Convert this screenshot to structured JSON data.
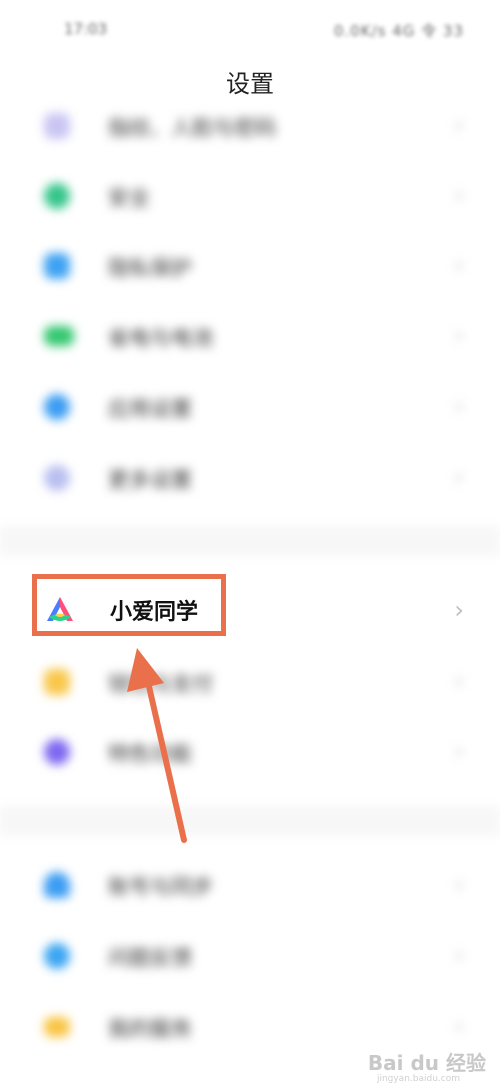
{
  "status_bar": {
    "time": "17:03",
    "indicators": "0.0K/s 4G 令 33"
  },
  "title": "设置",
  "group1": [
    {
      "label": "指纹、人脸与密码",
      "icon": "fingerprint-icon",
      "color": "#a7a1e6"
    },
    {
      "label": "安全",
      "icon": "shield-icon",
      "color": "#34c58a"
    },
    {
      "label": "隐私保护",
      "icon": "privacy-icon",
      "color": "#3ea2f2"
    },
    {
      "label": "省电与电池",
      "icon": "battery-icon",
      "color": "#33c76f"
    },
    {
      "label": "应用设置",
      "icon": "apps-icon",
      "color": "#3a9cf2"
    },
    {
      "label": "更多设置",
      "icon": "more-icon",
      "color": "#9ea6e8"
    }
  ],
  "highlight": {
    "label": "小爱同学",
    "icon": "xiaoai-icon",
    "box_color": "#e9704b"
  },
  "group2": [
    {
      "label": "钱包与支付",
      "icon": "wallet-icon",
      "color": "#f9c74a"
    },
    {
      "label": "特色功能",
      "icon": "features-icon",
      "color": "#7d67f0"
    }
  ],
  "group3": [
    {
      "label": "账号与同步",
      "icon": "account-icon",
      "color": "#3a9cf2"
    },
    {
      "label": "问题反馈",
      "icon": "feedback-icon",
      "color": "#3aa5f2"
    },
    {
      "label": "我的服务",
      "icon": "service-icon",
      "color": "#f9c441"
    }
  ],
  "watermark": {
    "brand": "Bai du 经验",
    "site": "jingyan.baidu.com"
  }
}
